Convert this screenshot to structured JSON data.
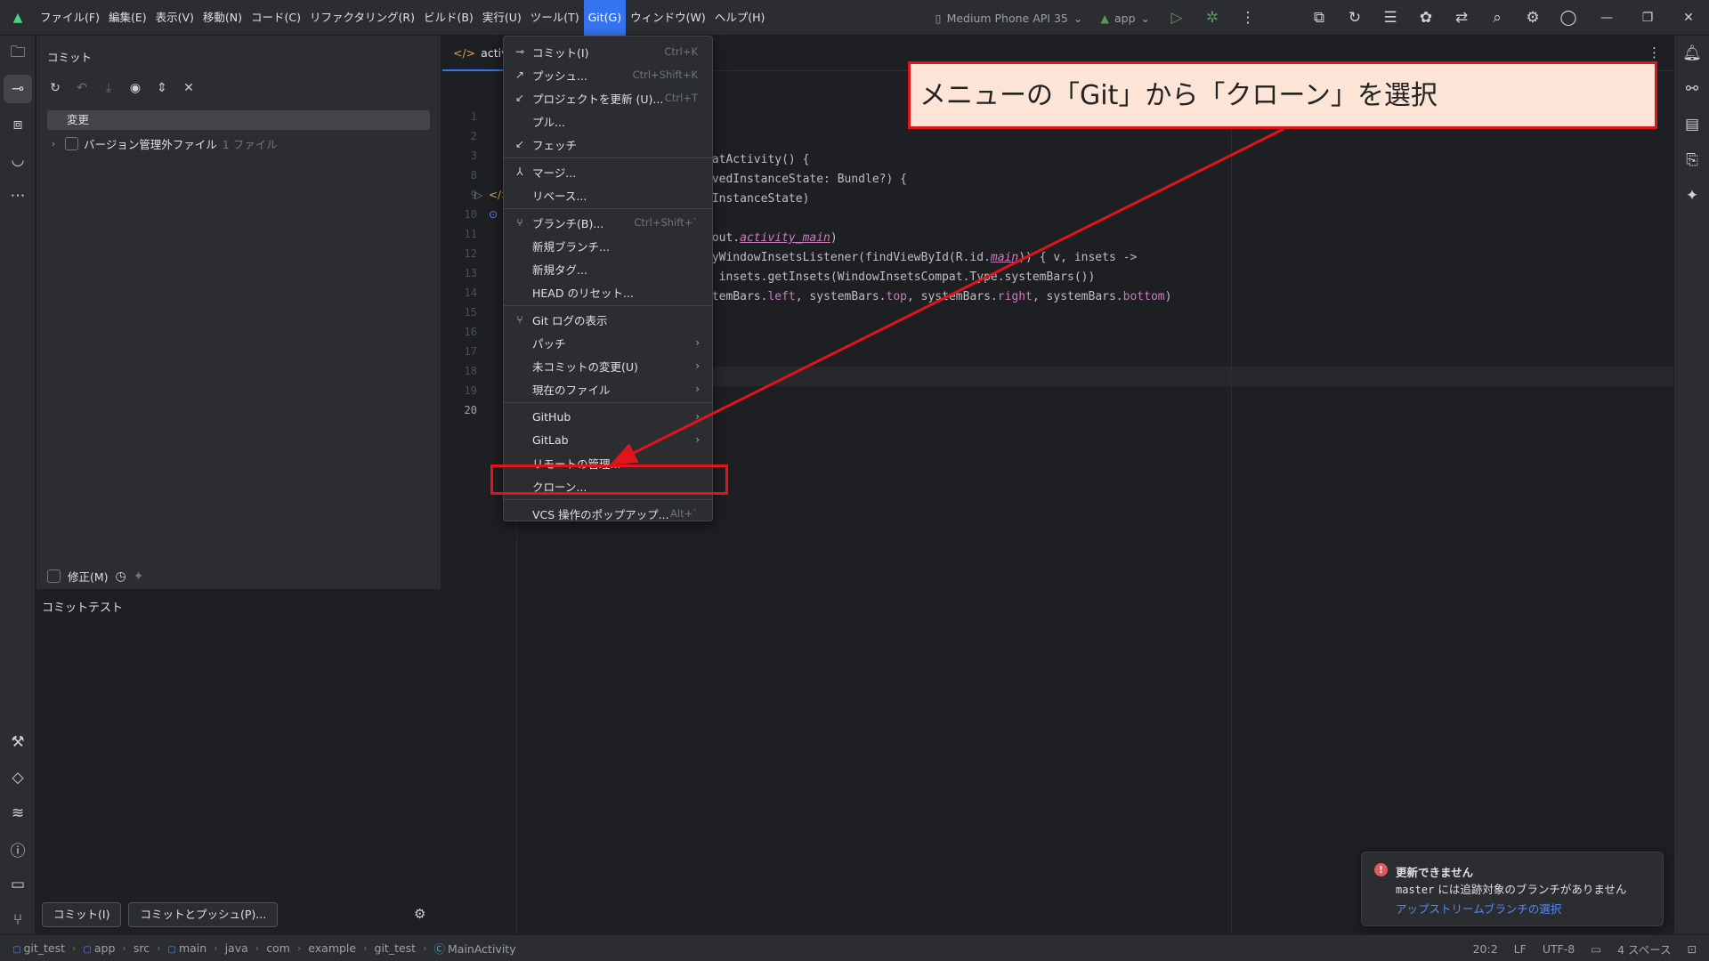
{
  "menubar": {
    "items": [
      "ファイル(F)",
      "編集(E)",
      "表示(V)",
      "移動(N)",
      "コード(C)",
      "リファクタリング(R)",
      "ビルド(B)",
      "実行(U)",
      "ツール(T)",
      "Git(G)",
      "ウィンドウ(W)",
      "ヘルプ(H)"
    ],
    "active": "Git(G)"
  },
  "toolbar": {
    "device": "Medium Phone API 35",
    "run_config": "app"
  },
  "commit_panel": {
    "title": "コミット",
    "changes_label": "変更",
    "unversioned_label": "バージョン管理外ファイル",
    "unversioned_count": "1 ファイル",
    "amend_label": "修正(M)",
    "message": "コミットテスト",
    "commit_button": "コミット(I)",
    "commit_push_button": "コミットとプッシュ(P)..."
  },
  "editor": {
    "tab_label": "activity",
    "line_numbers": [
      "1",
      "2",
      "3",
      "8",
      "9",
      "10",
      "11",
      "12",
      "13",
      "14",
      "15",
      "16",
      "17",
      "18",
      "19",
      "20"
    ],
    "current_line": "20",
    "code": {
      "l1": "t",
      "l9": "patActivity() {",
      "l10": "avedInstanceState: Bundle?) {",
      "l11": "dInstanceState)",
      "l13_a": "yout.",
      "l13_b": "activity_main",
      "l13_c": ")",
      "l14_a": "lyWindowInsetsListener(findViewById(R.id.",
      "l14_b": "main",
      "l14_c": ")) { v, insets ->",
      "l15": "= insets.getInsets(WindowInsetsCompat.Type.systemBars())",
      "l16_a": "stemBars.",
      "l16_b": "left",
      "l16_c": ", systemBars.",
      "l16_d": "top",
      "l16_e": ", systemBars.",
      "l16_f": "right",
      "l16_g": ", systemBars.",
      "l16_h": "bottom",
      "l16_i": ")"
    }
  },
  "git_menu": {
    "items": [
      {
        "label": "コミット(I)",
        "shortcut": "Ctrl+K",
        "icon": "commit-icon"
      },
      {
        "label": "プッシュ...",
        "shortcut": "Ctrl+Shift+K",
        "icon": "push-icon"
      },
      {
        "label": "プロジェクトを更新 (U)...",
        "shortcut": "Ctrl+T",
        "icon": "update-icon"
      },
      {
        "label": "プル..."
      },
      {
        "label": "フェッチ",
        "icon": "fetch-icon"
      },
      {
        "label": "マージ...",
        "icon": "merge-icon"
      },
      {
        "label": "リベース..."
      },
      {
        "label": "ブランチ(B)...",
        "shortcut": "Ctrl+Shift+`",
        "icon": "branch-icon"
      },
      {
        "label": "新規ブランチ..."
      },
      {
        "label": "新規タグ..."
      },
      {
        "label": "HEAD のリセット..."
      },
      {
        "label": "Git ログの表示",
        "icon": "git-log-icon"
      },
      {
        "label": "パッチ",
        "submenu": true
      },
      {
        "label": "未コミットの変更(U)",
        "submenu": true
      },
      {
        "label": "現在のファイル",
        "submenu": true
      },
      {
        "label": "GitHub",
        "submenu": true
      },
      {
        "label": "GitLab",
        "submenu": true
      },
      {
        "label": "リモートの管理..."
      },
      {
        "label": "クローン..."
      },
      {
        "label": "VCS 操作のポップアップ...",
        "shortcut": "Alt+`"
      }
    ]
  },
  "annotation": {
    "callout_text": "メニューの「Git」から「クローン」を選択",
    "highlight_color": "#e0151b",
    "callout_bg": "#fce4d6"
  },
  "notification": {
    "title": "更新できません",
    "body_mono": "master",
    "body_rest": " には追跡対象のブランチがありません",
    "link": "アップストリームブランチの選択"
  },
  "statusbar": {
    "breadcrumbs": [
      "git_test",
      "app",
      "src",
      "main",
      "java",
      "com",
      "example",
      "git_test",
      "MainActivity"
    ],
    "position": "20:2",
    "line_ending": "LF",
    "encoding": "UTF-8",
    "indent": "4 スペース"
  },
  "colors": {
    "accent": "#3574f0",
    "background": "#1e1f22",
    "panel": "#2b2d30",
    "error": "#db5c5c",
    "link": "#548af7"
  }
}
